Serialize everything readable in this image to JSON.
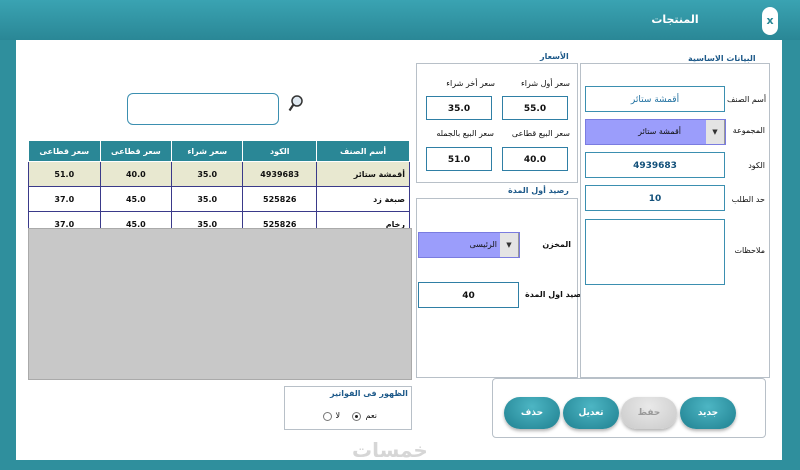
{
  "window": {
    "title": "المنتجات",
    "close_label": "x"
  },
  "search": {
    "value": ""
  },
  "table": {
    "headers": [
      "سعر قطاعى",
      "سعر قطاعى",
      "سعر شراء",
      "الكود",
      "أسم الصنف"
    ],
    "rows": [
      [
        "51.0",
        "40.0",
        "35.0",
        "4939683",
        "أقمشة ستائر"
      ],
      [
        "37.0",
        "45.0",
        "35.0",
        "525826",
        "صبغة زد"
      ],
      [
        "37.0",
        "45.0",
        "35.0",
        "525826",
        "رخام"
      ]
    ]
  },
  "prices": {
    "title": "الأسعار",
    "first_purchase_label": "سعر أول شراء",
    "first_purchase_value": "55.0",
    "last_purchase_label": "سعر أخر شراء",
    "last_purchase_value": "35.0",
    "retail_label": "سعر البيع قطاعى",
    "retail_value": "40.0",
    "wholesale_label": "سعر البيع بالجمله",
    "wholesale_value": "51.0"
  },
  "opening": {
    "title": "رصيد أول المدة",
    "warehouse_label": "المخزن",
    "warehouse_value": "الرئيسى",
    "balance_label": "رصيد اول المدة",
    "balance_value": "40"
  },
  "basic": {
    "title": "البيانات الاساسية",
    "name_label": "أسم الصنف",
    "name_value": "أقمشة ستائر",
    "group_label": "المجموعة",
    "group_value": "أقمشة ستائر",
    "code_label": "الكود",
    "code_value": "4939683",
    "limit_label": "حد الطلب",
    "limit_value": "10",
    "notes_label": "ملاحظات",
    "notes_value": ""
  },
  "invoices": {
    "title": "الظهور فى الفواتير",
    "yes_label": "نعم",
    "no_label": "لا"
  },
  "actions": {
    "new_label": "جديد",
    "save_label": "حفظ",
    "edit_label": "تعديل",
    "delete_label": "حذف"
  },
  "watermark": "خمسات",
  "colors": {
    "accent": "#2a8796",
    "select_bg": "#9b9dfb",
    "selected_row": "#e8e8d0"
  }
}
